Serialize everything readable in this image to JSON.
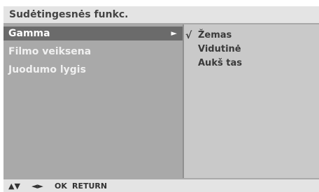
{
  "title": "Sudėtingesnės funkc.",
  "menu": {
    "items": [
      {
        "label": "Gamma",
        "arrow": "►"
      },
      {
        "label": "Filmo veiksena"
      },
      {
        "label": "Juodumo lygis"
      }
    ]
  },
  "submenu": {
    "check": "√",
    "options": [
      {
        "label": "Žemas"
      },
      {
        "label": "Vidutinė"
      },
      {
        "label": "Aukš tas"
      }
    ]
  },
  "footer": {
    "updown": "▲▼",
    "leftright": "◄►",
    "ok": "OK",
    "return": "RETURN"
  },
  "colors": {
    "title_bg": "#e4e4e4",
    "left_panel": "#a9a9a9",
    "selected": "#6b6b6b",
    "right_panel": "#c9c9c9"
  }
}
